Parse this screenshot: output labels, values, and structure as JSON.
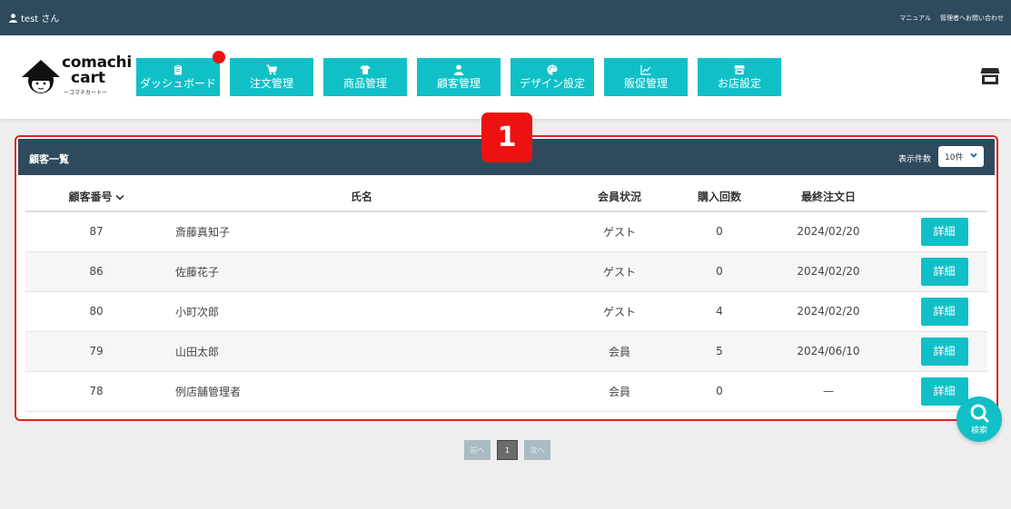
{
  "topbar": {
    "user_label": "test さん",
    "links": [
      "マニュアル",
      "管理者へお問い合わせ"
    ]
  },
  "logo": {
    "line1": "comachi",
    "line2": "cart",
    "sub": "ーコマチカートー"
  },
  "nav": [
    {
      "label": "ダッシュボード",
      "icon": "clipboard-icon",
      "notify": true
    },
    {
      "label": "注文管理",
      "icon": "cart-icon"
    },
    {
      "label": "商品管理",
      "icon": "tshirt-icon"
    },
    {
      "label": "顧客管理",
      "icon": "user-icon"
    },
    {
      "label": "デザイン設定",
      "icon": "palette-icon"
    },
    {
      "label": "販促管理",
      "icon": "chart-line-icon"
    },
    {
      "label": "お店設定",
      "icon": "store-icon"
    }
  ],
  "panel": {
    "title": "顧客一覧",
    "per_page_label": "表示件数",
    "per_page_value": "10件"
  },
  "annotation_badge": "1",
  "table": {
    "headers": [
      "顧客番号",
      "氏名",
      "会員状況",
      "購入回数",
      "最終注文日",
      ""
    ],
    "rows": [
      {
        "id": "87",
        "name": "斎藤真知子",
        "status": "ゲスト",
        "count": "0",
        "last_order": "2024/02/20",
        "action": "詳細"
      },
      {
        "id": "86",
        "name": "佐藤花子",
        "status": "ゲスト",
        "count": "0",
        "last_order": "2024/02/20",
        "action": "詳細"
      },
      {
        "id": "80",
        "name": "小町次郎",
        "status": "ゲスト",
        "count": "4",
        "last_order": "2024/02/20",
        "action": "詳細"
      },
      {
        "id": "79",
        "name": "山田太郎",
        "status": "会員",
        "count": "5",
        "last_order": "2024/06/10",
        "action": "詳細"
      },
      {
        "id": "78",
        "name": "例店舗管理者",
        "status": "会員",
        "count": "0",
        "last_order": "—",
        "action": "詳細"
      }
    ]
  },
  "pager": {
    "prev": "前へ",
    "current": "1",
    "next": "次へ"
  },
  "search_fab": {
    "label": "検索"
  },
  "colors": {
    "header_dark": "#2e4a5c",
    "accent": "#11c0c7",
    "alert": "#ee1111"
  }
}
